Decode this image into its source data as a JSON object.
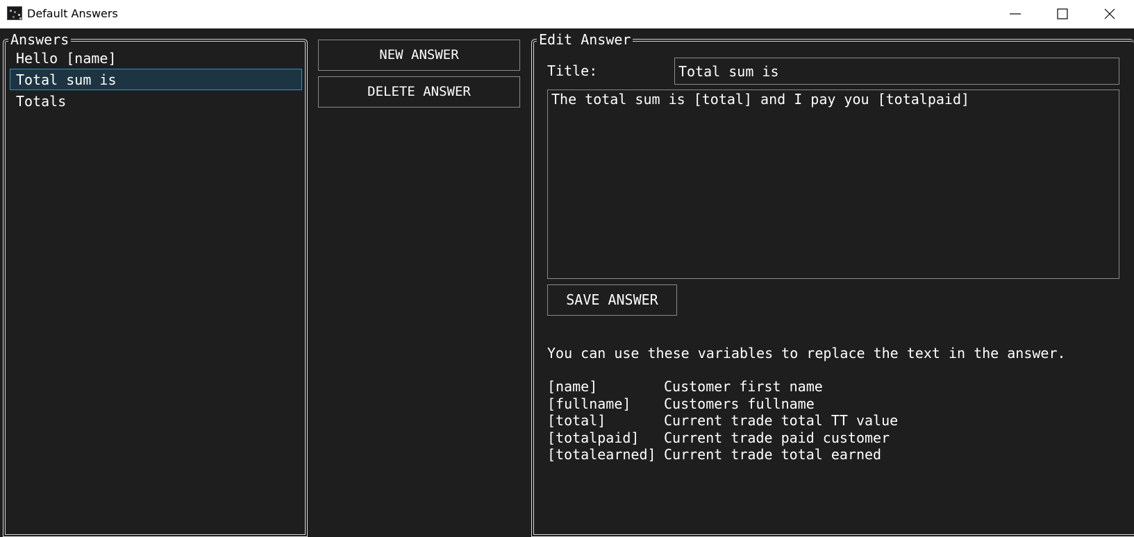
{
  "window": {
    "title": "Default Answers",
    "icon": "app-icon"
  },
  "answers_group": {
    "label": "Answers",
    "items": [
      {
        "label": "Hello [name]",
        "selected": false
      },
      {
        "label": "Total sum is",
        "selected": true
      },
      {
        "label": "Totals",
        "selected": false
      }
    ]
  },
  "actions": {
    "new_answer": "NEW ANSWER",
    "delete_answer": "DELETE ANSWER"
  },
  "edit_group": {
    "label": "Edit Answer",
    "title_label": "Title:",
    "title_value": "Total sum is",
    "body_value": "The total sum is [total] and I pay you [totalpaid]",
    "save_label": "SAVE ANSWER",
    "hint": "You can use these variables to replace the text in the answer.",
    "variables": [
      {
        "name": "[name]",
        "description": "Customer first name"
      },
      {
        "name": "[fullname]",
        "description": "Customers fullname"
      },
      {
        "name": "[total]",
        "description": "Current trade total TT value"
      },
      {
        "name": "[totalpaid]",
        "description": "Current trade paid customer"
      },
      {
        "name": "[totalearned]",
        "description": "Current trade total earned"
      }
    ]
  },
  "colors": {
    "background": "#1e1e1e",
    "selection_bg": "#1d3542",
    "selection_border": "#2e93c9",
    "border": "#8a8a8a"
  }
}
